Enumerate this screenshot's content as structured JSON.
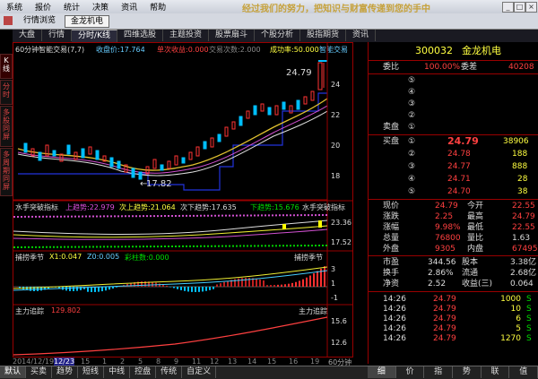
{
  "menu": {
    "items": [
      "系统",
      "报价",
      "统计",
      "决策",
      "资讯",
      "帮助"
    ],
    "slogan": "经过我们的努力，把知识与财富传递到您的手中"
  },
  "secondbar": {
    "left": "行情浏览",
    "tab": "金龙机电"
  },
  "tabs": [
    "大盘",
    "行情",
    "分时/K线",
    "四维选股",
    "主题投资",
    "股票扇斗",
    "个股分析",
    "股指期货",
    "资讯"
  ],
  "vtabs": [
    "K线",
    "分时",
    "多股同屏",
    "多周期同屏"
  ],
  "main_chart": {
    "title": "60分钟智能交易(7,7)",
    "ma_label": "收盘价:17.764",
    "sub1": "单次收益:0.000",
    "sub2": "交易次数:2.000",
    "success": "成功率:50.000",
    "smart": "智能交易",
    "high_label": "24.79",
    "low_label": "17.82",
    "axis": [
      "24",
      "22",
      "20",
      "18"
    ]
  },
  "sub_chart1": {
    "name": "水手突破指标",
    "up": "上趋势:22.979",
    "up2": "次上趋势:21.064",
    "down2": "次下趋势:17.635",
    "down": "下趋势:15.676",
    "name_r": "水手突破指标",
    "axis": [
      "23.36",
      "17.52"
    ]
  },
  "sub_chart2": {
    "name": "捕捞季节",
    "x": "X1:0.047",
    "z": "Z0:0.005",
    "color": "彩柱数:0.000",
    "name_r": "捕捞季节",
    "axis": [
      "3",
      "1",
      "-1"
    ]
  },
  "sub_chart3": {
    "name": "主力追踪",
    "val": "129.802",
    "name_r": "主力追踪",
    "axis": [
      "15.6",
      "12.6"
    ]
  },
  "dates": [
    "2014/12/19",
    "12/23",
    "15",
    "1",
    "2",
    "5",
    "8",
    "9",
    "11",
    "12",
    "13",
    "14",
    "15",
    "16",
    "19"
  ],
  "date_end": "60分钟",
  "stock": {
    "code": "300032",
    "name": "金龙机电"
  },
  "weibi": {
    "label": "委比",
    "val": "100.00%",
    "label2": "委差",
    "val2": "40208"
  },
  "sell": [
    {
      "l": "卖盘",
      "n": "⑤",
      "p": "",
      "v": ""
    },
    {
      "l": "",
      "n": "④",
      "p": "",
      "v": ""
    },
    {
      "l": "",
      "n": "③",
      "p": "",
      "v": ""
    },
    {
      "l": "",
      "n": "②",
      "p": "",
      "v": ""
    },
    {
      "l": "卖盘",
      "n": "①",
      "p": "",
      "v": ""
    }
  ],
  "buy": [
    {
      "l": "买盘",
      "n": "①",
      "p": "24.79",
      "v": "38906"
    },
    {
      "l": "",
      "n": "②",
      "p": "24.78",
      "v": "188"
    },
    {
      "l": "",
      "n": "③",
      "p": "24.77",
      "v": "888"
    },
    {
      "l": "",
      "n": "④",
      "p": "24.71",
      "v": "28"
    },
    {
      "l": "",
      "n": "⑤",
      "p": "24.70",
      "v": "38"
    }
  ],
  "quote": [
    {
      "a": "现价",
      "b": "24.79",
      "c": "今开",
      "d": "22.55"
    },
    {
      "a": "涨跌",
      "b": "2.25",
      "c": "最高",
      "d": "24.79"
    },
    {
      "a": "涨幅",
      "b": "9.98%",
      "c": "最低",
      "d": "22.55"
    },
    {
      "a": "总量",
      "b": "76800",
      "c": "量比",
      "d": "1.63"
    },
    {
      "a": "外盘",
      "b": "9305",
      "c": "内盘",
      "d": "67495"
    }
  ],
  "quote2": [
    {
      "a": "市盈",
      "b": "344.56",
      "c": "股本",
      "d": "3.38亿"
    },
    {
      "a": "换手",
      "b": "2.86%",
      "c": "流通",
      "d": "2.68亿"
    },
    {
      "a": "净资",
      "b": "2.52",
      "c": "收益(三)",
      "d": "0.064"
    }
  ],
  "ticks": [
    {
      "t": "14:26",
      "p": "24.79",
      "v": "1000",
      "f": "S"
    },
    {
      "t": "14:26",
      "p": "24.79",
      "v": "10",
      "f": "S"
    },
    {
      "t": "14:26",
      "p": "24.79",
      "v": "6",
      "f": "S"
    },
    {
      "t": "14:26",
      "p": "24.79",
      "v": "5",
      "f": "S"
    },
    {
      "t": "14:26",
      "p": "24.79",
      "v": "1270",
      "f": "S"
    }
  ],
  "btabs": [
    "默认",
    "买卖",
    "趋势",
    "短线",
    "中线",
    "控盘",
    "传统",
    "自定义"
  ],
  "rbtabs": [
    "细",
    "价",
    "指",
    "势",
    "联",
    "值"
  ]
}
